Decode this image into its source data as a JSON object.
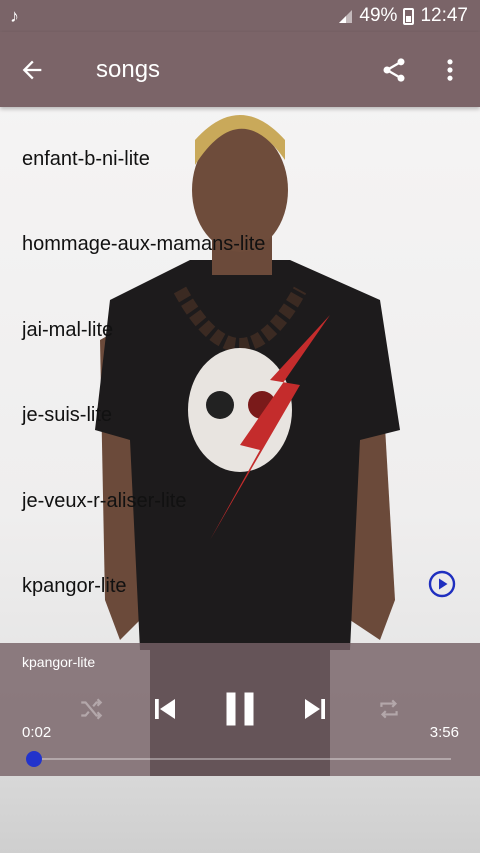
{
  "status_bar": {
    "battery": "49%",
    "time": "12:47"
  },
  "toolbar": {
    "title": "songs"
  },
  "songs": [
    {
      "title": "enfant-b-ni-lite"
    },
    {
      "title": "hommage-aux-mamans-lite"
    },
    {
      "title": "jai-mal-lite"
    },
    {
      "title": "je-suis-lite"
    },
    {
      "title": "je-veux-r-aliser-lite"
    },
    {
      "title": "kpangor-lite"
    }
  ],
  "player": {
    "now_playing": "kpangor-lite",
    "elapsed": "0:02",
    "duration": "3:56",
    "progress": 0.009,
    "accent_color": "#2233cc"
  },
  "colors": {
    "toolbar": "#7b6468",
    "play_icon": "#1f2fbf"
  },
  "icons": [
    "music-note-icon",
    "signal-icon",
    "battery-icon",
    "back-arrow-icon",
    "share-icon",
    "more-vert-icon",
    "play-circle-icon",
    "shuffle-icon",
    "skip-previous-icon",
    "pause-icon",
    "skip-next-icon",
    "repeat-icon"
  ]
}
